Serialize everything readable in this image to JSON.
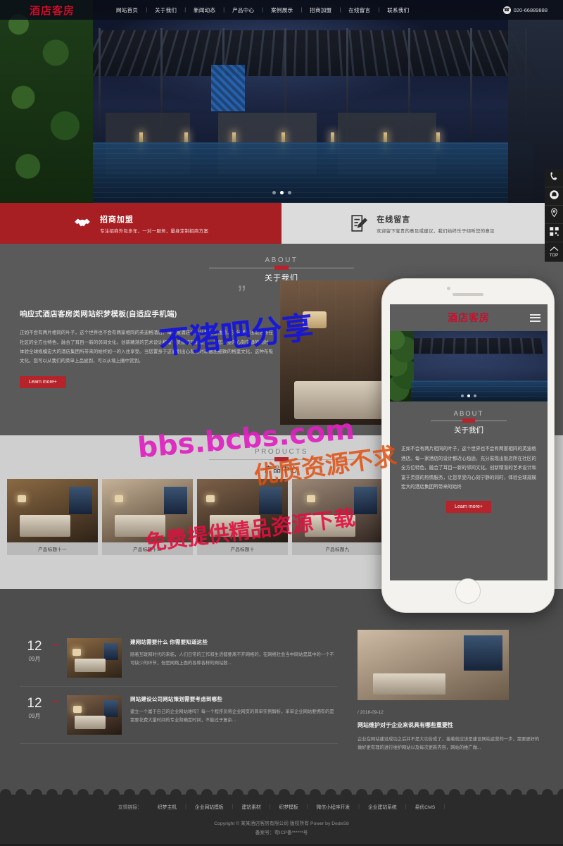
{
  "site": {
    "logo": "酒店客房",
    "phone": "020-66889888"
  },
  "nav": {
    "items": [
      {
        "label": "网站首页"
      },
      {
        "label": "关于我们"
      },
      {
        "label": "新闻动态"
      },
      {
        "label": "产品中心"
      },
      {
        "label": "案例展示"
      },
      {
        "label": "招商加盟"
      },
      {
        "label": "在线留言"
      },
      {
        "label": "联系我们"
      }
    ],
    "separator": "|"
  },
  "banners": [
    {
      "title": "招商加盟",
      "subtitle": "专注招商外包多年，一对一服务，量身定制招商方案",
      "icon": "handshake-icon",
      "color": "#a81f23"
    },
    {
      "title": "在线留言",
      "subtitle": "欢迎留下宝贵的意见或建议，我们始终乐于倾听您的意见",
      "icon": "message-pen-icon",
      "color": "#dcdcdc"
    }
  ],
  "sidebar": {
    "items": [
      {
        "icon": "phone-icon"
      },
      {
        "icon": "headset-icon"
      },
      {
        "icon": "location-pin-icon"
      },
      {
        "icon": "qrcode-icon"
      },
      {
        "icon": "top-arrow-icon",
        "label": "TOP"
      }
    ]
  },
  "about": {
    "en": "ABOUT",
    "cn": "关于我们",
    "quote": "”",
    "title": "响应式酒店客房类网站织梦模板(自适应手机端)",
    "text": "正如不会有两片相同的叶子，这个世界也不会有两家相同的英迪格酒店。每一家酒店的设计都近心烛逅，充分展现出饭店所在社区的全方位特色，融合了耳目一新的邻间文化。创新精湛的艺术设计和富于灵感的热情服务，让您享受内心刻宁静的同时，体验全球规模宏大的酒店集团所带来的始终如一的入住享受。当您置身于这家别出心裁地时新搬出细致的格里文化，这种布吸文化，您可以从我们的菜单上品尝到，可以从墙上圈中赏到。",
    "learn_more": "Learn more+"
  },
  "phone_mock": {
    "logo": "酒店客房",
    "about_en": "ABOUT",
    "about_cn": "关于我们",
    "about_text": "正如不会有两片相同的叶子，这个世界也不会有两家相同的英迪格酒店。每一家酒店的设计都近心烛逅，充分展现出饭店所在社区的全方位特色，融合了耳目一新的邻间文化。创新精湛的艺术设计和富于灵感的热情服务，让您享受内心刻宁静的同时，体验全球规模宏大的酒店集团所带来的始终",
    "learn_more": "Learn more+"
  },
  "products": {
    "en": "PRODUCTS",
    "cn": "产品中心",
    "items": [
      {
        "title": "产品标题十一"
      },
      {
        "title": "产品标题十二"
      },
      {
        "title": "产品标题十"
      },
      {
        "title": "产品标题九"
      }
    ]
  },
  "news": {
    "items": [
      {
        "day": "12",
        "month": "09月",
        "title": "建网站需要什么 你需要知道这些",
        "desc": "随着互联网时代的来临，人们日常的工作和生活都要离不开网络的，在网络社会当中网站是其中的一个不可缺少的环节，但是网络上面的各种各样的网站数..."
      },
      {
        "day": "12",
        "month": "09月",
        "title": "网站建设公司网站策划需要考虑到哪些",
        "desc": "建立一个属于自己的企业网站难吗？每一个程序员将企业网页的简单实例解析，单单企业网站要拥有的是需要花费大量时间的专业和确定时间，不能过于复杂..."
      }
    ],
    "featured": {
      "date": "/ 2018-09-12",
      "title": "网站维护对于企业来说具有哪些重要性",
      "desc": "企业在网站建设成功之后并不是大功告成了，接着就应该是建设网站运营的一步，需要更好的做好更有理的进行维护网站以及每次更新内容，网站的推广做..."
    }
  },
  "footer": {
    "links_label": "友情链接：",
    "links": [
      {
        "label": "织梦主机"
      },
      {
        "label": "企业网站模板"
      },
      {
        "label": "建站素材"
      },
      {
        "label": "织梦模板"
      },
      {
        "label": "微信小程序开发"
      },
      {
        "label": "企业建站系统"
      },
      {
        "label": "易优CMS"
      }
    ],
    "divider": "|",
    "copyright": "Copyright © 某某酒店客房有限公司 版权所有 Power by DedeS8",
    "icp": "备案号：粤ICP备******号"
  },
  "watermarks": {
    "w1": "不猪吧分享",
    "w2": "bbs.bcbs.com",
    "w3": "免费提供精品资源下载",
    "w4": "优质资源不求"
  },
  "colors": {
    "brand_red": "#b4242a",
    "banner_red": "#a81f23",
    "logo_red": "#c8102e"
  }
}
